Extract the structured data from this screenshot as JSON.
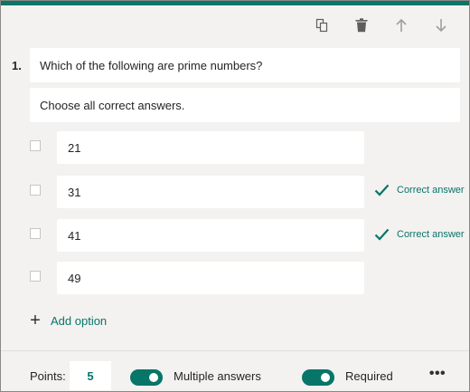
{
  "toolbar": {
    "icons": [
      "copy-icon",
      "delete-icon",
      "move-up-icon",
      "move-down-icon"
    ]
  },
  "question": {
    "number": "1.",
    "title": "Which of the following are prime numbers?",
    "subtitle": "Choose all correct answers."
  },
  "options": [
    {
      "value": "21",
      "checked": false,
      "correct_label": ""
    },
    {
      "value": "31",
      "checked": false,
      "correct_label": "Correct answer"
    },
    {
      "value": "41",
      "checked": false,
      "correct_label": "Correct answer"
    },
    {
      "value": "49",
      "checked": false,
      "correct_label": ""
    }
  ],
  "add_option_label": "Add option",
  "footer": {
    "points_label": "Points:",
    "points_value": "5",
    "multiple_answers_label": "Multiple answers",
    "multiple_answers_on": true,
    "required_label": "Required",
    "required_on": true,
    "more_icon": "ellipsis-icon"
  },
  "colors": {
    "accent": "#077568",
    "card_bg": "#f3f2f1",
    "field_bg": "#ffffff"
  }
}
